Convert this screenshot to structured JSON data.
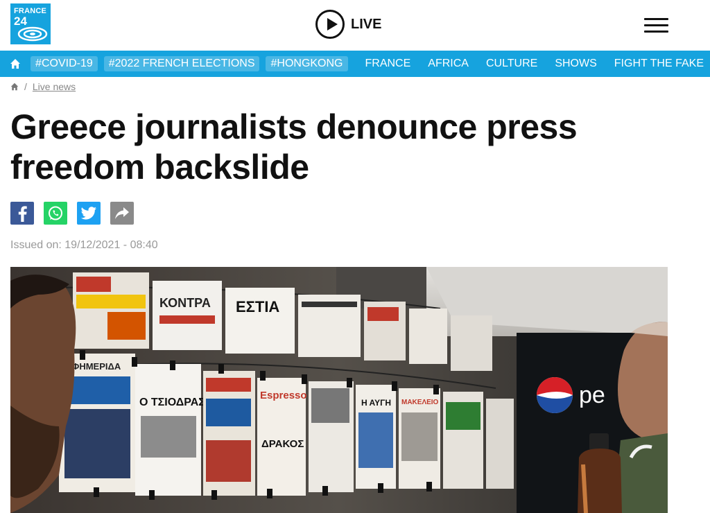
{
  "brand": {
    "line1": "FRANCE",
    "line2": "24"
  },
  "header": {
    "live_label": "LIVE"
  },
  "nav": {
    "tags": [
      "#COVID-19",
      "#2022 FRENCH ELECTIONS",
      "#HONGKONG"
    ],
    "sections": [
      "FRANCE",
      "AFRICA",
      "CULTURE",
      "SHOWS",
      "FIGHT THE FAKE"
    ]
  },
  "breadcrumb": {
    "separator": "/",
    "current": "Live news"
  },
  "article": {
    "title": "Greece journalists denounce press freedom backslide",
    "issued": "Issued on: 19/12/2021 - 08:40"
  },
  "photo": {
    "newspaper_texts": [
      "ΕΦΗΜΕΡΙΔΑ",
      "Ο ΤΣΙΟΔΡΑΣ",
      "Espresso",
      "ΔΡΑΚΟΣ",
      "Η ΑΥΓΗ",
      "ΚΟΝΤΡΑ",
      "ΕΣΤΙΑ",
      "ΜΑΚΕΛΕΙΟ"
    ],
    "pepsi_text": "pe"
  },
  "colors": {
    "brand_blue": "#16a3de",
    "facebook": "#3b5998",
    "whatsapp": "#25d366",
    "twitter": "#1da1f2",
    "share": "#8a8a8a"
  }
}
